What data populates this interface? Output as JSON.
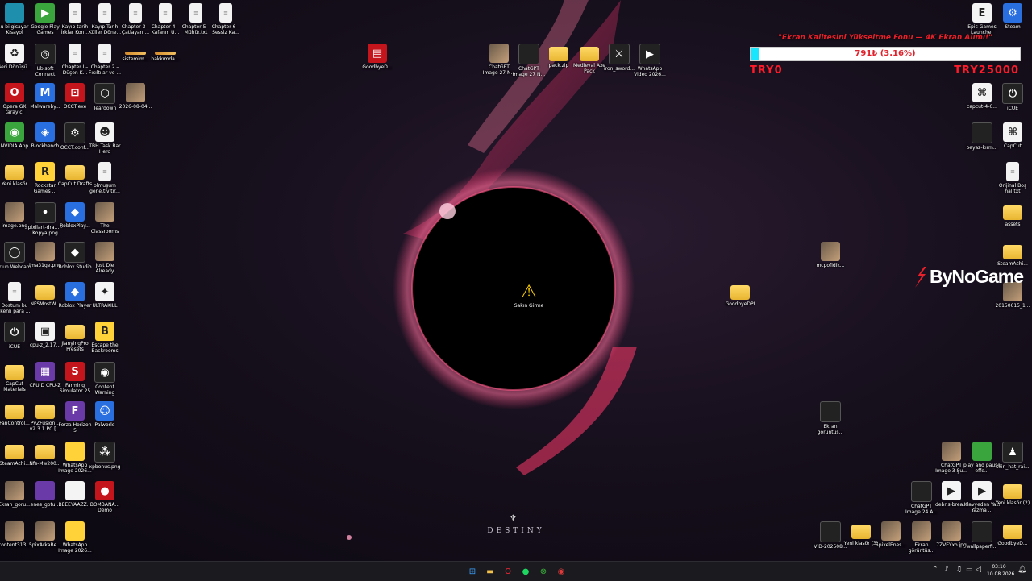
{
  "colors": {
    "donation_fill": "#18e6ff",
    "donation_text": "#e0202a",
    "taskbar_bg": "#1b1b1f",
    "folder": "#f3c24a"
  },
  "wallpaper": {
    "brand_text": "DESTINY"
  },
  "donation": {
    "title": "\"Ekran Kalitesini Yükseltme Fonu — 4K Ekran Alımı!\"",
    "progress_text": "791₺ (3.16%)",
    "progress_fraction": 0.0316,
    "min_label": "TRY0",
    "max_label": "TRY25000"
  },
  "watermark": {
    "text": "ByNoGame"
  },
  "icons": [
    {
      "id": "bu-bilgisayar",
      "label": "Bu bilgisayar - Kısayol",
      "icon": "monitor-icon",
      "style": "g-teal",
      "glyph": ""
    },
    {
      "id": "google-play-games",
      "label": "Google Play Games",
      "icon": "google-play-icon",
      "style": "g-green",
      "glyph": "▶"
    },
    {
      "id": "kayip-tarih-1",
      "label": "Kayıp tarih İrklar Kon...",
      "icon": "text-file-icon",
      "style": "g-file",
      "glyph": "≡"
    },
    {
      "id": "kayip-tarih-2",
      "label": "Kayıp Tarih Küller Döne...",
      "icon": "text-file-icon",
      "style": "g-file",
      "glyph": "≡"
    },
    {
      "id": "chapter-3",
      "label": "Chapter 3 – Çatlayan ...",
      "icon": "text-file-icon",
      "style": "g-file",
      "glyph": "≡"
    },
    {
      "id": "chapter-4",
      "label": "Chapter 4 – Kafanın U...",
      "icon": "text-file-icon",
      "style": "g-file",
      "glyph": "≡"
    },
    {
      "id": "chapter-5",
      "label": "Chapter 5 – Mühür.txt",
      "icon": "text-file-icon",
      "style": "g-file",
      "glyph": "≡"
    },
    {
      "id": "chapter-6",
      "label": "Chapter 6 – Sessiz Ka...",
      "icon": "text-file-icon",
      "style": "g-file",
      "glyph": "≡"
    },
    {
      "id": "geri-donusum",
      "label": "Geri Dönüşü...",
      "icon": "recycle-bin-icon",
      "style": "g-white",
      "glyph": "♻"
    },
    {
      "id": "ubisoft",
      "label": "Ubisoft Connect",
      "icon": "ubisoft-icon",
      "style": "g-dark",
      "glyph": "◎"
    },
    {
      "id": "chapter-1",
      "label": "Chapter I – Düşen K...",
      "icon": "text-file-icon",
      "style": "g-file",
      "glyph": "≡"
    },
    {
      "id": "chapter-2",
      "label": "Chapter 2 – Fısıltılar ve ...",
      "icon": "text-file-icon",
      "style": "g-file",
      "glyph": "≡"
    },
    {
      "id": "sistemim",
      "label": "sistemim...",
      "icon": "shortcut-bar-icon",
      "style": "g-bar",
      "glyph": ""
    },
    {
      "id": "hakkimda",
      "label": "hakkımda...",
      "icon": "shortcut-bar-icon",
      "style": "g-bar",
      "glyph": ""
    },
    {
      "id": "opera-gx",
      "label": "Opera GX tarayıcı",
      "icon": "opera-gx-icon",
      "style": "g-red",
      "glyph": "O"
    },
    {
      "id": "malwarebytes",
      "label": "Malwareby...",
      "icon": "malwarebytes-icon",
      "style": "g-blue",
      "glyph": "M"
    },
    {
      "id": "occt-exe",
      "label": "OCCT.exe",
      "icon": "occt-icon",
      "style": "g-red",
      "glyph": "⊡"
    },
    {
      "id": "teardown",
      "label": "Teardown",
      "icon": "teardown-icon",
      "style": "g-dark",
      "glyph": "⬡"
    },
    {
      "id": "video-2026",
      "label": "2026-08-04...",
      "icon": "video-file-icon",
      "style": "g-img",
      "glyph": ""
    },
    {
      "id": "nvidia",
      "label": "NVIDIA App",
      "icon": "nvidia-icon",
      "style": "g-green",
      "glyph": "◉"
    },
    {
      "id": "blockbench",
      "label": "Blockbench",
      "icon": "blockbench-icon",
      "style": "g-blue",
      "glyph": "◈"
    },
    {
      "id": "occt-conf",
      "label": "OCCT.conf...",
      "icon": "config-file-icon",
      "style": "g-dark",
      "glyph": "⚙"
    },
    {
      "id": "tbh-taskbar",
      "label": "TBH Task Bar Hero",
      "icon": "tbh-icon",
      "style": "g-white",
      "glyph": "☻"
    },
    {
      "id": "yeni-klasor",
      "label": "Yeni klasör",
      "icon": "folder-icon",
      "style": "g-folder",
      "glyph": ""
    },
    {
      "id": "rockstar",
      "label": "Rockstar Games ...",
      "icon": "rockstar-icon",
      "style": "g-yellow",
      "glyph": "R"
    },
    {
      "id": "capcut-drafts",
      "label": "CapCut Drafts",
      "icon": "folder-icon",
      "style": "g-folder",
      "glyph": ""
    },
    {
      "id": "olmuyum",
      "label": "olmuşum gene.tivitir...",
      "icon": "text-file-icon",
      "style": "g-file",
      "glyph": "≡"
    },
    {
      "id": "image-png",
      "label": "image.png",
      "icon": "image-file-icon",
      "style": "g-img",
      "glyph": ""
    },
    {
      "id": "pixilart",
      "label": "pixilart-dra... - Kopya.png",
      "icon": "image-file-icon",
      "style": "g-dark",
      "glyph": "•"
    },
    {
      "id": "robloxplayer",
      "label": "RobloxPlay...",
      "icon": "roblox-icon",
      "style": "g-blue",
      "glyph": "◆"
    },
    {
      "id": "the-classrooms",
      "label": "The Classrooms",
      "icon": "classrooms-icon",
      "style": "g-img",
      "glyph": ""
    },
    {
      "id": "iriun",
      "label": "Iriun Webcam",
      "icon": "webcam-icon",
      "style": "g-dark",
      "glyph": "◯"
    },
    {
      "id": "ima31ge",
      "label": "ima31ge.png",
      "icon": "image-file-icon",
      "style": "g-img",
      "glyph": ""
    },
    {
      "id": "roblox-studio",
      "label": "Roblox Studio",
      "icon": "roblox-studio-icon",
      "style": "g-dark",
      "glyph": "◆"
    },
    {
      "id": "just-die",
      "label": "Just Die Already",
      "icon": "just-die-icon",
      "style": "g-img",
      "glyph": ""
    },
    {
      "id": "dostum",
      "label": "Dostum bu İkenli para ...",
      "icon": "text-file-icon",
      "style": "g-file",
      "glyph": "≡"
    },
    {
      "id": "nfsmostw",
      "label": "NFSMostW...",
      "icon": "folder-icon",
      "style": "g-folder",
      "glyph": ""
    },
    {
      "id": "roblox-player",
      "label": "Roblox Player",
      "icon": "roblox-icon",
      "style": "g-blue",
      "glyph": "◆"
    },
    {
      "id": "ultrakill",
      "label": "ULTRAKILL",
      "icon": "ultrakill-icon",
      "style": "g-white",
      "glyph": "✦"
    },
    {
      "id": "icue-left",
      "label": "iCUE",
      "icon": "icue-icon",
      "style": "g-dark",
      "glyph": "⏻"
    },
    {
      "id": "cpu-z-2",
      "label": "cpu-z_2.17...",
      "icon": "archive-icon",
      "style": "g-white",
      "glyph": "▣"
    },
    {
      "id": "jianying",
      "label": "JianyingPro Presets",
      "icon": "folder-icon",
      "style": "g-folder",
      "glyph": ""
    },
    {
      "id": "escape-backrooms",
      "label": "Escape the Backrooms",
      "icon": "backrooms-icon",
      "style": "g-yellow",
      "glyph": "B"
    },
    {
      "id": "capcut-materials",
      "label": "CapCut Materials",
      "icon": "folder-icon",
      "style": "g-folder",
      "glyph": ""
    },
    {
      "id": "cpuid",
      "label": "CPUID CPU-Z",
      "icon": "cpuz-icon",
      "style": "g-purple",
      "glyph": "▦"
    },
    {
      "id": "farming-sim",
      "label": "Farming Simulator 25",
      "icon": "farming-icon",
      "style": "g-red",
      "glyph": "S"
    },
    {
      "id": "content-warning",
      "label": "Content Warning",
      "icon": "content-warning-icon",
      "style": "g-dark",
      "glyph": "◉"
    },
    {
      "id": "fancontrol",
      "label": "FanControl...",
      "icon": "folder-icon",
      "style": "g-folder",
      "glyph": ""
    },
    {
      "id": "pvzfusion",
      "label": "PvZFusion... v2.3.1 PC [...",
      "icon": "folder-icon",
      "style": "g-folder",
      "glyph": ""
    },
    {
      "id": "forza",
      "label": "Forza Horizon 5",
      "icon": "forza-icon",
      "style": "g-purple",
      "glyph": "F"
    },
    {
      "id": "palworld",
      "label": "Palworld",
      "icon": "palworld-icon",
      "style": "g-blue",
      "glyph": "☺"
    },
    {
      "id": "steamachi-left",
      "label": "SteamAchi...",
      "icon": "folder-icon",
      "style": "g-folder",
      "glyph": ""
    },
    {
      "id": "nfs-mw",
      "label": "Nfs-Mw200...",
      "icon": "folder-icon",
      "style": "g-folder",
      "glyph": ""
    },
    {
      "id": "whatsapp-img-1",
      "label": "WhatsApp Image 2026...",
      "icon": "image-file-icon",
      "style": "g-yellow",
      "glyph": ""
    },
    {
      "id": "xpbonus",
      "label": "xpbonus.png",
      "icon": "image-file-icon",
      "style": "g-dark",
      "glyph": "⁂"
    },
    {
      "id": "ekran-goru-left",
      "label": "Ekran_goru...",
      "icon": "image-file-icon",
      "style": "g-img",
      "glyph": ""
    },
    {
      "id": "enes-gotu",
      "label": "enes_gotu...",
      "icon": "image-file-icon",
      "style": "g-purple",
      "glyph": ""
    },
    {
      "id": "beeeyaazz",
      "label": "BEEEYAAZZ...",
      "icon": "image-file-icon",
      "style": "g-white",
      "glyph": ""
    },
    {
      "id": "bombana",
      "label": "BOMBANA... Demo",
      "icon": "bombana-icon",
      "style": "g-red",
      "glyph": "●"
    },
    {
      "id": "content313",
      "label": "content313...",
      "icon": "image-file-icon",
      "style": "g-img",
      "glyph": ""
    },
    {
      "id": "5pixarkabe",
      "label": "5pixArkaBe...",
      "icon": "image-file-icon",
      "style": "g-img",
      "glyph": ""
    },
    {
      "id": "whatsapp-img-2",
      "label": "WhatsApp Image 2026...",
      "icon": "image-file-icon",
      "style": "g-yellow",
      "glyph": ""
    },
    {
      "id": "goodbyedpi-top",
      "label": "GoodbyeD...",
      "icon": "winrar-icon",
      "style": "g-red",
      "glyph": "▤"
    },
    {
      "id": "chatgpt-img-27",
      "label": "ChatGPT Image 27 N...",
      "icon": "image-file-icon",
      "style": "g-img",
      "glyph": ""
    },
    {
      "id": "chatgpt-img-2",
      "label": "ChatGPT Image 27 N...",
      "icon": "image-file-icon",
      "style": "g-dark",
      "glyph": ""
    },
    {
      "id": "pack-folder",
      "label": "pack.zip",
      "icon": "folder-icon",
      "style": "g-folder",
      "glyph": ""
    },
    {
      "id": "medieval-axe",
      "label": "Medieval Axe Pack",
      "icon": "folder-icon",
      "style": "g-folder",
      "glyph": ""
    },
    {
      "id": "iron-sword",
      "label": "iron_sword...",
      "icon": "image-file-icon",
      "style": "g-dark",
      "glyph": "⚔"
    },
    {
      "id": "whatsapp-video",
      "label": "WhatsApp Video 2026...",
      "icon": "video-file-icon",
      "style": "g-dark",
      "glyph": "▶"
    },
    {
      "id": "sakin-girme",
      "label": "Sakın Girme",
      "icon": "warning-icon",
      "style": "g-warn",
      "glyph": "⚠"
    },
    {
      "id": "goodbyedpi-mid",
      "label": "GoodbyeDPI",
      "icon": "folder-icon",
      "style": "g-folder",
      "glyph": ""
    },
    {
      "id": "mcpofidik",
      "label": "mcpofidik...",
      "icon": "image-file-icon",
      "style": "g-img",
      "glyph": ""
    },
    {
      "id": "ekran-goruntusu-mid",
      "label": "Ekran görüntüs...",
      "icon": "image-file-icon",
      "style": "g-dark",
      "glyph": ""
    },
    {
      "id": "epic-games",
      "label": "Epic Games Launcher",
      "icon": "epic-games-icon",
      "style": "g-white",
      "glyph": "E"
    },
    {
      "id": "steam",
      "label": "Steam",
      "icon": "steam-icon",
      "style": "g-blue",
      "glyph": "⚙"
    },
    {
      "id": "capcut-4-6",
      "label": "capcut-4-6...",
      "icon": "capcut-icon",
      "style": "g-white",
      "glyph": "⌘"
    },
    {
      "id": "icue-right",
      "label": "iCUE",
      "icon": "icue-icon",
      "style": "g-dark",
      "glyph": "⏻"
    },
    {
      "id": "beyaz-kirm",
      "label": "beyaz-kırm...",
      "icon": "image-file-icon",
      "style": "g-dark",
      "glyph": ""
    },
    {
      "id": "capcut",
      "label": "CapCut",
      "icon": "capcut-icon",
      "style": "g-white",
      "glyph": "⌘"
    },
    {
      "id": "orijinal-bos",
      "label": "Orijinal Boş hal.txt",
      "icon": "text-file-icon",
      "style": "g-file",
      "glyph": "≡"
    },
    {
      "id": "assets",
      "label": "assets",
      "icon": "folder-icon",
      "style": "g-folder",
      "glyph": ""
    },
    {
      "id": "steamachi-right",
      "label": "SteamAchi...",
      "icon": "folder-icon",
      "style": "g-folder",
      "glyph": ""
    },
    {
      "id": "img-20150615",
      "label": "20150615_1...",
      "icon": "image-file-icon",
      "style": "g-img",
      "glyph": ""
    },
    {
      "id": "chatgpt-img-3",
      "label": "ChatGPT Image 3 Şu...",
      "icon": "image-file-icon",
      "style": "g-img",
      "glyph": ""
    },
    {
      "id": "play-pause",
      "label": "play and pause effe...",
      "icon": "image-file-icon",
      "style": "g-green",
      "glyph": ""
    },
    {
      "id": "skin-hat",
      "label": "skin_hat_rai...",
      "icon": "image-file-icon",
      "style": "g-dark",
      "glyph": "♟"
    },
    {
      "id": "chatgpt-img-24",
      "label": "ChatGPT Image 24 A...",
      "icon": "image-file-icon",
      "style": "g-dark",
      "glyph": ""
    },
    {
      "id": "debris-brea",
      "label": "debris-brea...",
      "icon": "video-file-icon",
      "style": "g-white",
      "glyph": "▶"
    },
    {
      "id": "klavyeden",
      "label": "Klavyeden Yazı Yazma ...",
      "icon": "video-file-icon",
      "style": "g-white",
      "glyph": "▶"
    },
    {
      "id": "yeni-klasor-2",
      "label": "Yeni klasör (2)",
      "icon": "folder-icon",
      "style": "g-folder",
      "glyph": ""
    },
    {
      "id": "vid-202508",
      "label": "VID-202508...",
      "icon": "video-file-icon",
      "style": "g-dark",
      "glyph": ""
    },
    {
      "id": "yeni-klasor-3",
      "label": "Yeni klasör (3)",
      "icon": "folder-icon",
      "style": "g-folder",
      "glyph": ""
    },
    {
      "id": "5pixelenes",
      "label": "5pixelEnes...",
      "icon": "image-file-icon",
      "style": "g-img",
      "glyph": ""
    },
    {
      "id": "ekran-goruntusu-br",
      "label": "Ekran görüntüs...",
      "icon": "image-file-icon",
      "style": "g-img",
      "glyph": ""
    },
    {
      "id": "7zveyxo",
      "label": "7ZVEYxo.jpg",
      "icon": "image-file-icon",
      "style": "g-img",
      "glyph": ""
    },
    {
      "id": "wallpaperfl",
      "label": "wallpaperfl...",
      "icon": "image-file-icon",
      "style": "g-dark",
      "glyph": ""
    },
    {
      "id": "goodbyedpi-br",
      "label": "GoodbyeD...",
      "icon": "folder-icon",
      "style": "g-folder",
      "glyph": ""
    }
  ],
  "taskbar": {
    "apps": [
      {
        "id": "start",
        "icon": "windows-start-icon",
        "glyph": "⊞",
        "color": "#3aa0ff"
      },
      {
        "id": "explorer",
        "icon": "file-explorer-icon",
        "glyph": "▬",
        "color": "#f3c24a"
      },
      {
        "id": "opera",
        "icon": "opera-gx-icon",
        "glyph": "O",
        "color": "#ff2a3a"
      },
      {
        "id": "spotify",
        "icon": "spotify-icon",
        "glyph": "●",
        "color": "#1ed760"
      },
      {
        "id": "xbox",
        "icon": "xbox-icon",
        "glyph": "⊗",
        "color": "#3ab53c"
      },
      {
        "id": "obs",
        "icon": "recording-app-icon",
        "glyph": "◉",
        "color": "#e23a3a"
      }
    ],
    "tray": [
      {
        "id": "chevron",
        "icon": "chevron-up-icon",
        "glyph": "⌃"
      },
      {
        "id": "mic",
        "icon": "microphone-icon",
        "glyph": "♪"
      },
      {
        "id": "speaker",
        "icon": "speaker-icon",
        "glyph": "♫"
      },
      {
        "id": "network",
        "icon": "network-icon",
        "glyph": "▭"
      },
      {
        "id": "volume",
        "icon": "volume-icon",
        "glyph": "◁"
      }
    ],
    "time": "03:10",
    "date": "10.08.2026"
  }
}
